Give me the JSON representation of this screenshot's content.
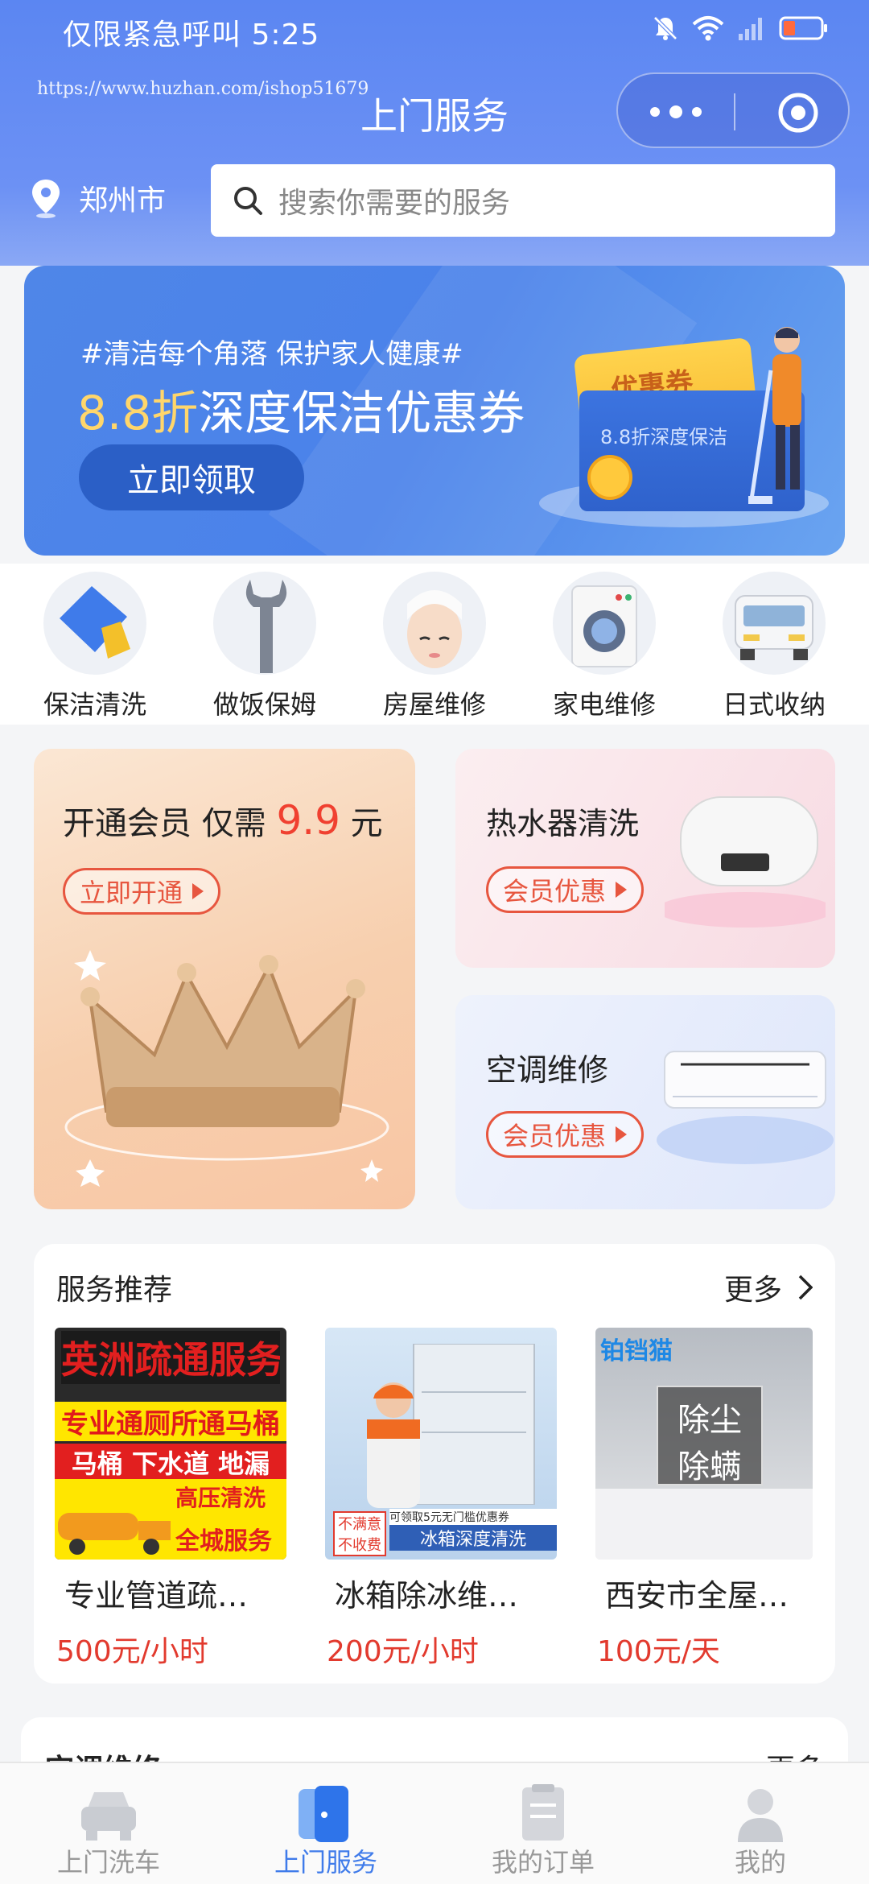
{
  "status_bar": {
    "text": "仅限紧急呼叫 5:25"
  },
  "header": {
    "watermark": "https://www.huzhan.com/ishop51679",
    "title": "上门服务",
    "location": "郑州市",
    "search_placeholder": "搜索你需要的服务"
  },
  "banner": {
    "subtitle": "#清洁每个角落 保护家人健康#",
    "title_highlight": "8.8折",
    "title_rest": "深度保洁优惠券",
    "button": "立即领取",
    "coupon_label": "优惠券",
    "envelope_text": "8.8折深度保洁"
  },
  "categories": [
    {
      "label": "保洁清洗",
      "icon": "cleaning-cloth-icon"
    },
    {
      "label": "做饭保姆",
      "icon": "wrench-icon"
    },
    {
      "label": "房屋维修",
      "icon": "face-care-icon"
    },
    {
      "label": "家电维修",
      "icon": "washing-machine-icon"
    },
    {
      "label": "日式收纳",
      "icon": "van-icon"
    }
  ],
  "promos": {
    "member": {
      "title_prefix": "开通会员 仅需 ",
      "price": "9.9",
      "unit": " 元",
      "button": "立即开通"
    },
    "water_heater": {
      "title": "热水器清洗",
      "button": "会员优惠"
    },
    "aircon": {
      "title": "空调维修",
      "button": "会员优惠"
    }
  },
  "recommend": {
    "title": "服务推荐",
    "more": "更多",
    "items": [
      {
        "name": "专业管道疏…",
        "price": "500元/小时",
        "img_lines": [
          "英洲疏通服务",
          "专业通厕所通马桶",
          "马桶 下水道 地漏",
          "高压清洗",
          "全城服务"
        ]
      },
      {
        "name": "冰箱除冰维…",
        "price": "200元/小时",
        "img_lines": [
          "冰箱深度清洗",
          "不满意",
          "不收费",
          "可领取5元无门槛优惠券"
        ]
      },
      {
        "name": "西安市全屋…",
        "price": "100元/天",
        "img_lines": [
          "除尘",
          "除螨",
          "铂铛猫"
        ]
      }
    ]
  },
  "next_section": {
    "title": "空调维修",
    "more": "更多"
  },
  "tabbar": [
    {
      "label": "上门洗车",
      "active": false
    },
    {
      "label": "上门服务",
      "active": true
    },
    {
      "label": "我的订单",
      "active": false
    },
    {
      "label": "我的",
      "active": false
    }
  ],
  "colors": {
    "brand": "#5b86f2",
    "accent_red": "#e23a2e",
    "tab_active": "#3f7bea"
  }
}
